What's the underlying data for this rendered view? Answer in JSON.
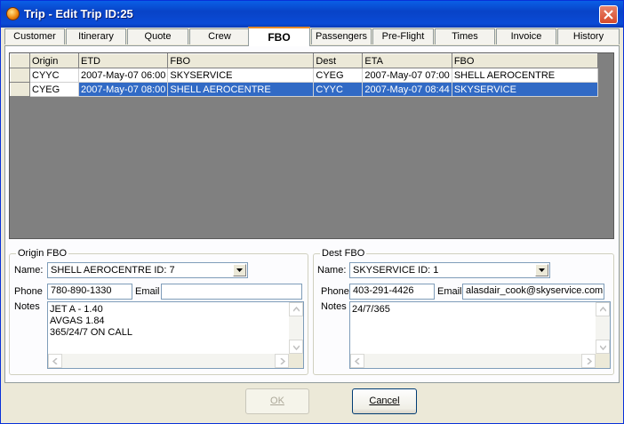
{
  "window": {
    "title": "Trip - Edit Trip ID:25"
  },
  "tabs": [
    {
      "label": "Customer"
    },
    {
      "label": "Itinerary"
    },
    {
      "label": "Quote"
    },
    {
      "label": "Crew"
    },
    {
      "label": "FBO",
      "active": true
    },
    {
      "label": "Passengers"
    },
    {
      "label": "Pre-Flight"
    },
    {
      "label": "Times"
    },
    {
      "label": "Invoice"
    },
    {
      "label": "History"
    }
  ],
  "grid": {
    "columns": [
      "Origin",
      "ETD",
      "FBO",
      "Dest",
      "ETA",
      "FBO"
    ],
    "rows": [
      [
        "CYYC",
        "2007-May-07 06:00",
        "SKYSERVICE",
        "CYEG",
        "2007-May-07 07:00",
        "SHELL AEROCENTRE"
      ],
      [
        "CYEG",
        "2007-May-07 08:00",
        "SHELL AEROCENTRE",
        "CYYC",
        "2007-May-07 08:44",
        "SKYSERVICE"
      ]
    ],
    "selected_row": 1
  },
  "origin_fbo": {
    "group_label": "Origin FBO",
    "name_label": "Name:",
    "name_value": "SHELL AEROCENTRE ID: 7",
    "phone_label": "Phone",
    "phone_value": "780-890-1330",
    "email_label": "Email",
    "email_value": "",
    "notes_label": "Notes",
    "notes_value": "JET A - 1.40\nAVGAS 1.84\n365/24/7 ON CALL"
  },
  "dest_fbo": {
    "group_label": "Dest FBO",
    "name_label": "Name:",
    "name_value": "SKYSERVICE ID: 1",
    "phone_label": "Phone",
    "phone_value": "403-291-4426",
    "email_label": "Email",
    "email_value": "alasdair_cook@skyservice.com",
    "notes_label": "Notes",
    "notes_value": "24/7/365"
  },
  "buttons": {
    "ok_label": "OK",
    "ok_enabled": false,
    "cancel_label": "Cancel"
  },
  "colors": {
    "titlebar": "#0a4bd6",
    "selection": "#316ac5",
    "active_tab_accent": "#e68b2c"
  }
}
